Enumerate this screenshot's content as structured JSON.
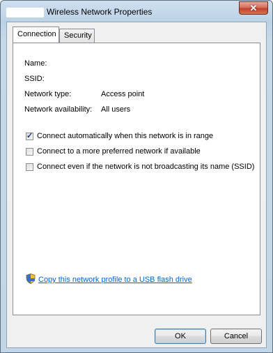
{
  "window": {
    "title": "Wireless Network Properties",
    "close_glyph": "✕"
  },
  "tabs": [
    {
      "label": "Connection",
      "active": true
    },
    {
      "label": "Security",
      "active": false
    }
  ],
  "properties": [
    {
      "label": "Name:",
      "value": ""
    },
    {
      "label": "SSID:",
      "value": ""
    },
    {
      "label": "Network type:",
      "value": "Access point"
    },
    {
      "label": "Network availability:",
      "value": "All users"
    }
  ],
  "options": [
    {
      "label": "Connect automatically when this network is in range",
      "checked": true
    },
    {
      "label": "Connect to a more preferred network if available",
      "checked": false
    },
    {
      "label": "Connect even if the network is not broadcasting its name (SSID)",
      "checked": false
    }
  ],
  "link": {
    "icon": "shield-icon",
    "text": "Copy this network profile to a USB flash drive"
  },
  "buttons": {
    "ok": "OK",
    "cancel": "Cancel"
  },
  "colors": {
    "link": "#0066cc",
    "close_button": "#c0412b"
  }
}
